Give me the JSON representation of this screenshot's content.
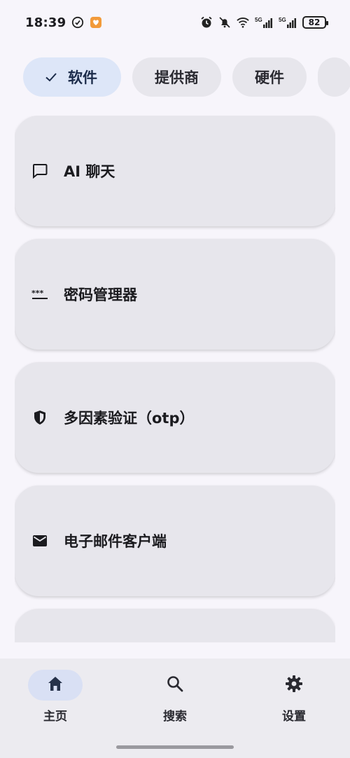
{
  "status_bar": {
    "time": "18:39",
    "battery": "82",
    "network_labels": [
      "5G",
      "5G"
    ]
  },
  "filters": {
    "chips": [
      {
        "label": "软件",
        "selected": true
      },
      {
        "label": "提供商",
        "selected": false
      },
      {
        "label": "硬件",
        "selected": false
      }
    ]
  },
  "list": {
    "items": [
      {
        "label": "AI 聊天",
        "icon": "chat-bubble-icon"
      },
      {
        "label": "密码管理器",
        "icon": "password-dots-icon"
      },
      {
        "label": "多因素验证（otp）",
        "icon": "shield-icon"
      },
      {
        "label": "电子邮件客户端",
        "icon": "mail-icon"
      }
    ]
  },
  "bottom_nav": {
    "items": [
      {
        "label": "主页",
        "icon": "home-icon",
        "active": true
      },
      {
        "label": "搜索",
        "icon": "search-icon",
        "active": false
      },
      {
        "label": "设置",
        "icon": "gear-icon",
        "active": false
      }
    ]
  },
  "colors": {
    "background": "#f7f5fb",
    "card": "#e7e6ec",
    "selected_chip": "#dde6f8",
    "active_nav_pill": "#d9e0f4",
    "text": "#1b1b1f"
  }
}
